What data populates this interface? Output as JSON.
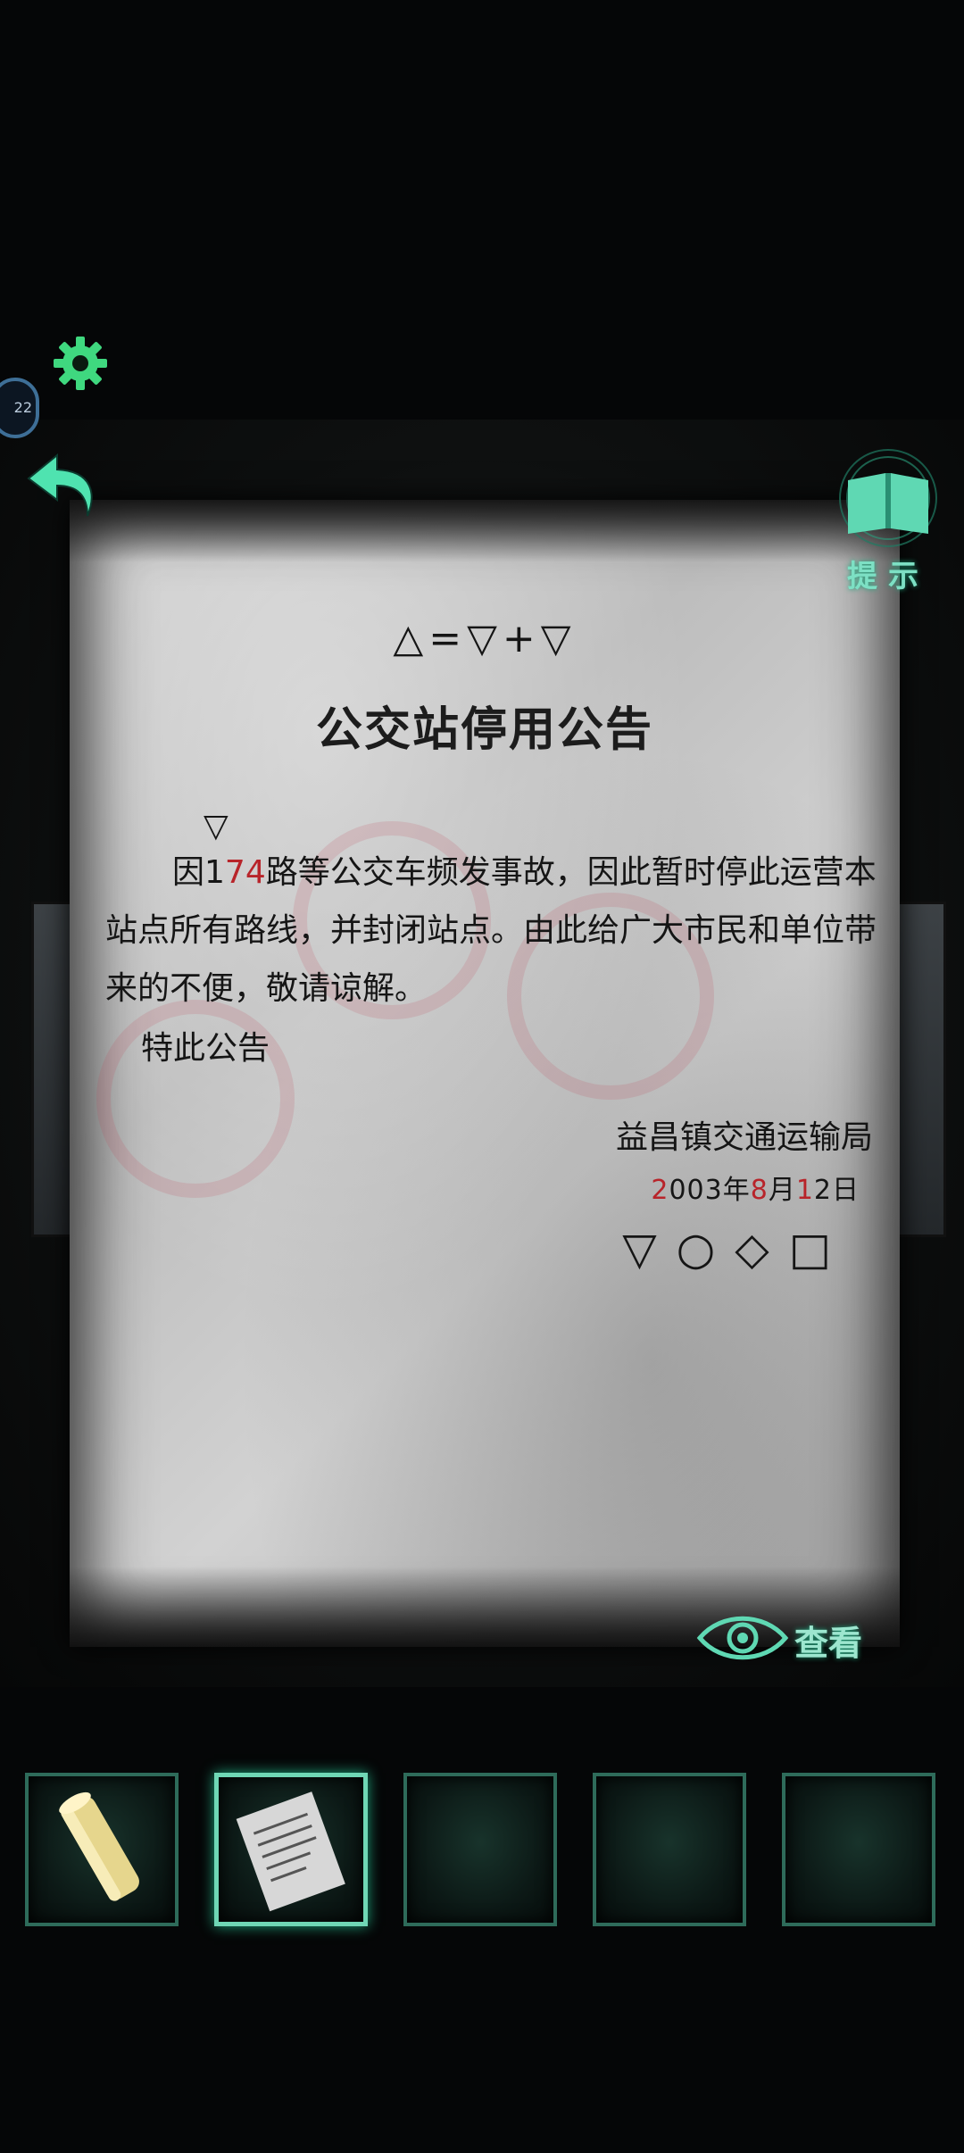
{
  "notice": {
    "symbol_line": "△=▽+▽",
    "title": "公交站停用公告",
    "marker_symbol": "▽",
    "body_segments": [
      "因1",
      "7",
      "4",
      "路等公交车频发事故，因此暂时停此运营本站点所有路线，并封闭站点。由此给广大市民和单位带来的不便，敬请谅解。"
    ],
    "closing": "特此公告",
    "organization": "益昌镇交通运输局",
    "date_segments": [
      "2",
      "00",
      "3",
      "年",
      "8",
      "月",
      "1",
      "2",
      "日"
    ],
    "shape_line": "▽○◇□"
  },
  "hud": {
    "profile_badge_text": "22",
    "hint_label": "提示",
    "view_label": "查看"
  },
  "inventory": {
    "slots": [
      {
        "item": "candle",
        "selected": false
      },
      {
        "item": "notice-paper",
        "selected": true
      },
      {
        "item": "",
        "selected": false
      },
      {
        "item": "",
        "selected": false
      },
      {
        "item": "",
        "selected": false
      }
    ]
  },
  "colors": {
    "accent": "#6fd7b5",
    "highlight_red": "#b8242a",
    "paper": "#c4c4c4"
  }
}
